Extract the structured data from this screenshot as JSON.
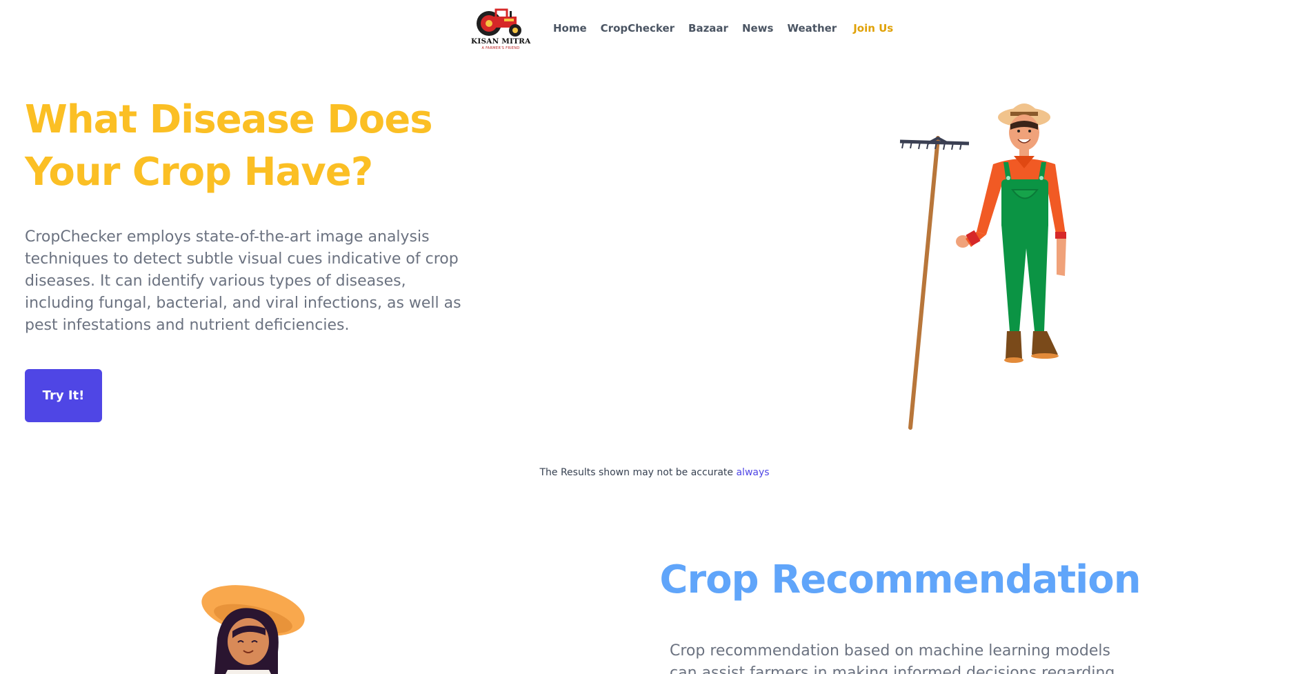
{
  "brand": {
    "name": "KISAN MITRA",
    "tagline": "A FARMER'S FRIEND",
    "colors": {
      "tractor_red": "#d62828",
      "accent_gold": "#fbbf24",
      "primary_indigo": "#4f46e5",
      "blue_heading": "#60a5fa"
    }
  },
  "nav": {
    "links": [
      {
        "label": "Home"
      },
      {
        "label": "CropChecker"
      },
      {
        "label": "Bazaar"
      },
      {
        "label": "News"
      },
      {
        "label": "Weather"
      }
    ],
    "join_label": "Join Us"
  },
  "hero": {
    "title_line1": "What Disease Does",
    "title_line2": "Your Crop Have?",
    "description": "CropChecker employs state-of-the-art image analysis techniques to detect subtle visual cues indicative of crop diseases. It can identify various types of diseases, including fungal, bacterial, and viral infections, as well as pest infestations and nutrient deficiencies.",
    "button_label": "Try It!",
    "illustration_icon": "farmer-with-rake-illustration"
  },
  "disclaimer": {
    "text": "The Results shown may not be accurate ",
    "link_text": "always"
  },
  "recommendation": {
    "title": "Crop Recommendation",
    "description": "Crop recommendation based on machine learning models can assist farmers in making informed decisions regarding",
    "illustration_icon": "woman-farmer-illustration"
  }
}
